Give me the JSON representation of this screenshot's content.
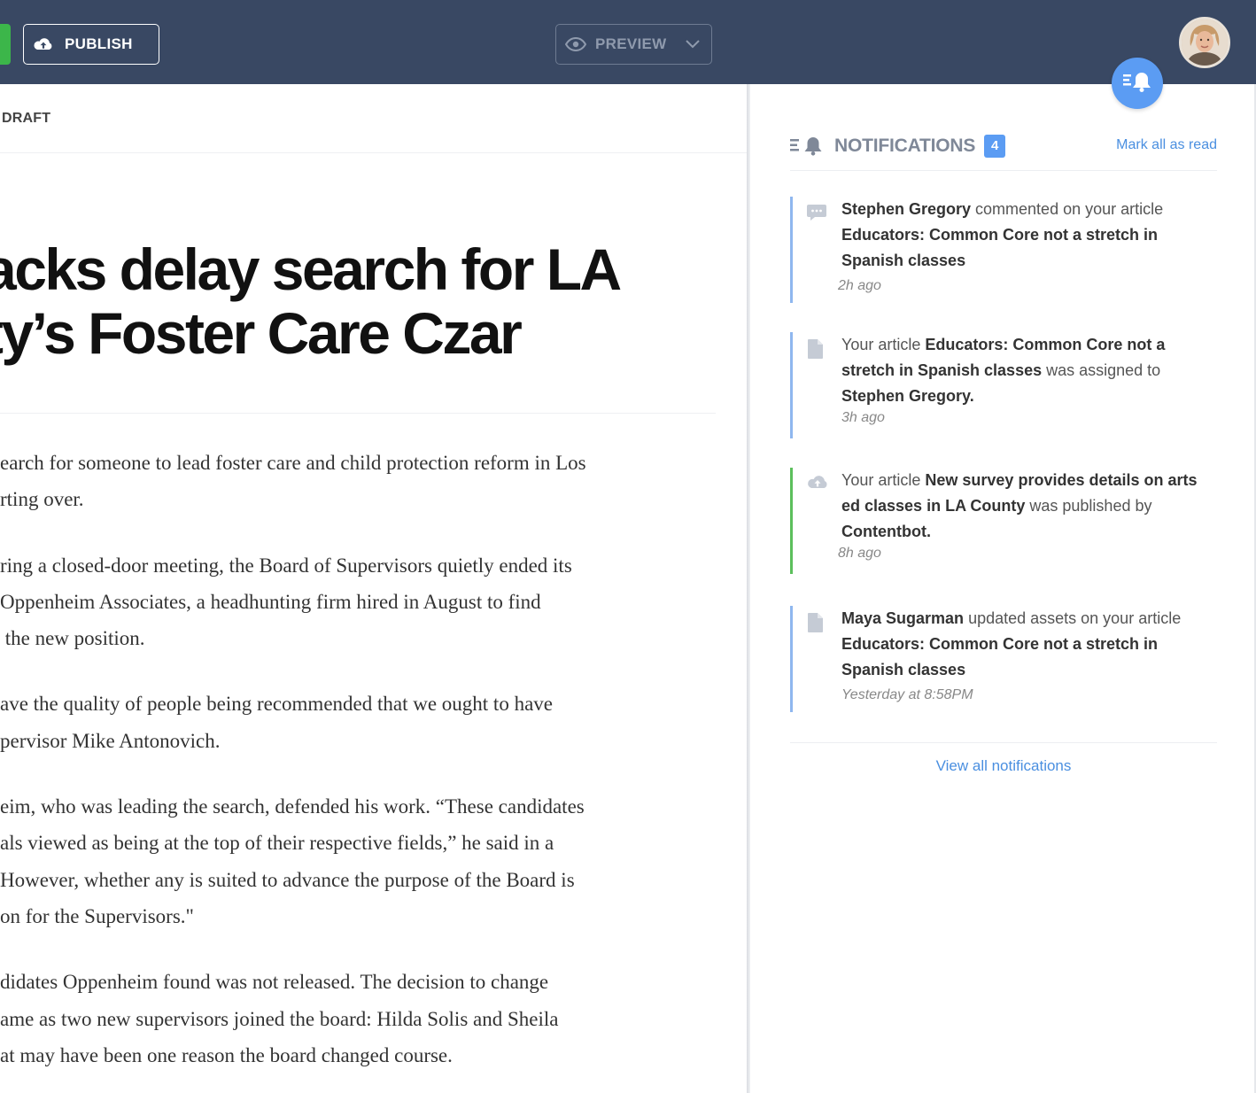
{
  "toolbar": {
    "publish_label": "PUBLISH",
    "preview_label": "PREVIEW",
    "icons": {
      "publish": "cloud-upload-icon",
      "preview": "eye-icon",
      "preview_dropdown": "chevron-down-icon",
      "notifications": "bell-icon"
    }
  },
  "article": {
    "status": "DRAFT",
    "headline": "acks delay search for LA\nty’s Foster Care Czar",
    "paragraphs": [
      "earch for someone to lead foster care and child protection reform in Los\nrting over.",
      "ring a closed-door meeting, the Board of Supervisors quietly ended its\nOppenheim Associates, a headhunting firm hired in August to find\n the new position.",
      "ave the quality of people being recommended that we ought to have\npervisor Mike Antonovich.",
      "eim, who was leading the search, defended his work. “These candidates\nals viewed as being at the top of their respective fields,” he said in a\nHowever, whether any is suited to advance the purpose of the Board is\non for the Supervisors.\"",
      "didates Oppenheim found was not released. The decision to change\name as two new supervisors joined the board: Hilda Solis and Sheila\nat may have been one reason the board changed course."
    ]
  },
  "notifications": {
    "title": "NOTIFICATIONS",
    "count": "4",
    "mark_all_read": "Mark all as read",
    "view_all": "View all notifications",
    "items": [
      {
        "icon": "comment-icon",
        "actor": "Stephen Gregory",
        "action": " commented on your article",
        "article": "Educators: Common Core not a stretch in Spanish classes",
        "time": "2h ago"
      },
      {
        "icon": "document-icon",
        "lead": "Your article ",
        "article": "Educators: Common Core not a stretch in Spanish classes",
        "middle": " was assigned to ",
        "target": "Stephen Gregory.",
        "time": "3h ago"
      },
      {
        "icon": "cloud-upload-icon",
        "lead": "Your article ",
        "article": "New survey provides details on arts ed classes in LA County",
        "middle": " was published by ",
        "target": "Contentbot.",
        "time": "8h ago"
      },
      {
        "icon": "document-icon",
        "actor": "Maya Sugarman",
        "action": " updated assets on your article",
        "article": "Educators: Common Core not a stretch in Spanish classes",
        "time": "Yesterday at 8:58PM"
      }
    ]
  },
  "colors": {
    "topbar": "#394863",
    "accent_blue": "#5b9cf3",
    "publish_green": "#3cb64a",
    "link_blue": "#4a8fe0"
  }
}
